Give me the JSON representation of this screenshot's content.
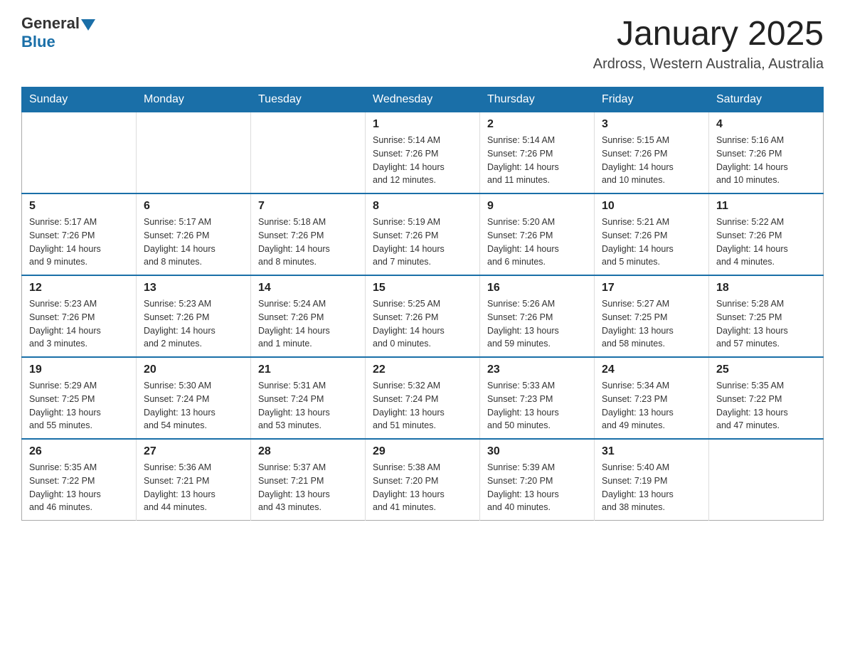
{
  "header": {
    "logo_general": "General",
    "logo_blue": "Blue",
    "title": "January 2025",
    "subtitle": "Ardross, Western Australia, Australia"
  },
  "days_of_week": [
    "Sunday",
    "Monday",
    "Tuesday",
    "Wednesday",
    "Thursday",
    "Friday",
    "Saturday"
  ],
  "weeks": [
    [
      {
        "day": "",
        "info": ""
      },
      {
        "day": "",
        "info": ""
      },
      {
        "day": "",
        "info": ""
      },
      {
        "day": "1",
        "info": "Sunrise: 5:14 AM\nSunset: 7:26 PM\nDaylight: 14 hours\nand 12 minutes."
      },
      {
        "day": "2",
        "info": "Sunrise: 5:14 AM\nSunset: 7:26 PM\nDaylight: 14 hours\nand 11 minutes."
      },
      {
        "day": "3",
        "info": "Sunrise: 5:15 AM\nSunset: 7:26 PM\nDaylight: 14 hours\nand 10 minutes."
      },
      {
        "day": "4",
        "info": "Sunrise: 5:16 AM\nSunset: 7:26 PM\nDaylight: 14 hours\nand 10 minutes."
      }
    ],
    [
      {
        "day": "5",
        "info": "Sunrise: 5:17 AM\nSunset: 7:26 PM\nDaylight: 14 hours\nand 9 minutes."
      },
      {
        "day": "6",
        "info": "Sunrise: 5:17 AM\nSunset: 7:26 PM\nDaylight: 14 hours\nand 8 minutes."
      },
      {
        "day": "7",
        "info": "Sunrise: 5:18 AM\nSunset: 7:26 PM\nDaylight: 14 hours\nand 8 minutes."
      },
      {
        "day": "8",
        "info": "Sunrise: 5:19 AM\nSunset: 7:26 PM\nDaylight: 14 hours\nand 7 minutes."
      },
      {
        "day": "9",
        "info": "Sunrise: 5:20 AM\nSunset: 7:26 PM\nDaylight: 14 hours\nand 6 minutes."
      },
      {
        "day": "10",
        "info": "Sunrise: 5:21 AM\nSunset: 7:26 PM\nDaylight: 14 hours\nand 5 minutes."
      },
      {
        "day": "11",
        "info": "Sunrise: 5:22 AM\nSunset: 7:26 PM\nDaylight: 14 hours\nand 4 minutes."
      }
    ],
    [
      {
        "day": "12",
        "info": "Sunrise: 5:23 AM\nSunset: 7:26 PM\nDaylight: 14 hours\nand 3 minutes."
      },
      {
        "day": "13",
        "info": "Sunrise: 5:23 AM\nSunset: 7:26 PM\nDaylight: 14 hours\nand 2 minutes."
      },
      {
        "day": "14",
        "info": "Sunrise: 5:24 AM\nSunset: 7:26 PM\nDaylight: 14 hours\nand 1 minute."
      },
      {
        "day": "15",
        "info": "Sunrise: 5:25 AM\nSunset: 7:26 PM\nDaylight: 14 hours\nand 0 minutes."
      },
      {
        "day": "16",
        "info": "Sunrise: 5:26 AM\nSunset: 7:26 PM\nDaylight: 13 hours\nand 59 minutes."
      },
      {
        "day": "17",
        "info": "Sunrise: 5:27 AM\nSunset: 7:25 PM\nDaylight: 13 hours\nand 58 minutes."
      },
      {
        "day": "18",
        "info": "Sunrise: 5:28 AM\nSunset: 7:25 PM\nDaylight: 13 hours\nand 57 minutes."
      }
    ],
    [
      {
        "day": "19",
        "info": "Sunrise: 5:29 AM\nSunset: 7:25 PM\nDaylight: 13 hours\nand 55 minutes."
      },
      {
        "day": "20",
        "info": "Sunrise: 5:30 AM\nSunset: 7:24 PM\nDaylight: 13 hours\nand 54 minutes."
      },
      {
        "day": "21",
        "info": "Sunrise: 5:31 AM\nSunset: 7:24 PM\nDaylight: 13 hours\nand 53 minutes."
      },
      {
        "day": "22",
        "info": "Sunrise: 5:32 AM\nSunset: 7:24 PM\nDaylight: 13 hours\nand 51 minutes."
      },
      {
        "day": "23",
        "info": "Sunrise: 5:33 AM\nSunset: 7:23 PM\nDaylight: 13 hours\nand 50 minutes."
      },
      {
        "day": "24",
        "info": "Sunrise: 5:34 AM\nSunset: 7:23 PM\nDaylight: 13 hours\nand 49 minutes."
      },
      {
        "day": "25",
        "info": "Sunrise: 5:35 AM\nSunset: 7:22 PM\nDaylight: 13 hours\nand 47 minutes."
      }
    ],
    [
      {
        "day": "26",
        "info": "Sunrise: 5:35 AM\nSunset: 7:22 PM\nDaylight: 13 hours\nand 46 minutes."
      },
      {
        "day": "27",
        "info": "Sunrise: 5:36 AM\nSunset: 7:21 PM\nDaylight: 13 hours\nand 44 minutes."
      },
      {
        "day": "28",
        "info": "Sunrise: 5:37 AM\nSunset: 7:21 PM\nDaylight: 13 hours\nand 43 minutes."
      },
      {
        "day": "29",
        "info": "Sunrise: 5:38 AM\nSunset: 7:20 PM\nDaylight: 13 hours\nand 41 minutes."
      },
      {
        "day": "30",
        "info": "Sunrise: 5:39 AM\nSunset: 7:20 PM\nDaylight: 13 hours\nand 40 minutes."
      },
      {
        "day": "31",
        "info": "Sunrise: 5:40 AM\nSunset: 7:19 PM\nDaylight: 13 hours\nand 38 minutes."
      },
      {
        "day": "",
        "info": ""
      }
    ]
  ]
}
